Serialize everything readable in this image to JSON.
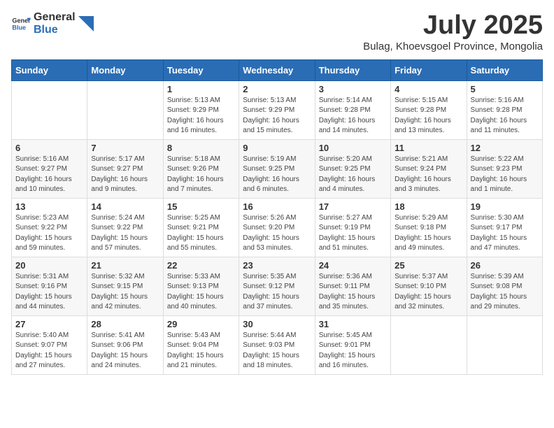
{
  "logo": {
    "general": "General",
    "blue": "Blue"
  },
  "title": "July 2025",
  "subtitle": "Bulag, Khoevsgoel Province, Mongolia",
  "days_of_week": [
    "Sunday",
    "Monday",
    "Tuesday",
    "Wednesday",
    "Thursday",
    "Friday",
    "Saturday"
  ],
  "weeks": [
    [
      {
        "day": "",
        "info": ""
      },
      {
        "day": "",
        "info": ""
      },
      {
        "day": "1",
        "info": "Sunrise: 5:13 AM\nSunset: 9:29 PM\nDaylight: 16 hours and 16 minutes."
      },
      {
        "day": "2",
        "info": "Sunrise: 5:13 AM\nSunset: 9:29 PM\nDaylight: 16 hours and 15 minutes."
      },
      {
        "day": "3",
        "info": "Sunrise: 5:14 AM\nSunset: 9:28 PM\nDaylight: 16 hours and 14 minutes."
      },
      {
        "day": "4",
        "info": "Sunrise: 5:15 AM\nSunset: 9:28 PM\nDaylight: 16 hours and 13 minutes."
      },
      {
        "day": "5",
        "info": "Sunrise: 5:16 AM\nSunset: 9:28 PM\nDaylight: 16 hours and 11 minutes."
      }
    ],
    [
      {
        "day": "6",
        "info": "Sunrise: 5:16 AM\nSunset: 9:27 PM\nDaylight: 16 hours and 10 minutes."
      },
      {
        "day": "7",
        "info": "Sunrise: 5:17 AM\nSunset: 9:27 PM\nDaylight: 16 hours and 9 minutes."
      },
      {
        "day": "8",
        "info": "Sunrise: 5:18 AM\nSunset: 9:26 PM\nDaylight: 16 hours and 7 minutes."
      },
      {
        "day": "9",
        "info": "Sunrise: 5:19 AM\nSunset: 9:25 PM\nDaylight: 16 hours and 6 minutes."
      },
      {
        "day": "10",
        "info": "Sunrise: 5:20 AM\nSunset: 9:25 PM\nDaylight: 16 hours and 4 minutes."
      },
      {
        "day": "11",
        "info": "Sunrise: 5:21 AM\nSunset: 9:24 PM\nDaylight: 16 hours and 3 minutes."
      },
      {
        "day": "12",
        "info": "Sunrise: 5:22 AM\nSunset: 9:23 PM\nDaylight: 16 hours and 1 minute."
      }
    ],
    [
      {
        "day": "13",
        "info": "Sunrise: 5:23 AM\nSunset: 9:22 PM\nDaylight: 15 hours and 59 minutes."
      },
      {
        "day": "14",
        "info": "Sunrise: 5:24 AM\nSunset: 9:22 PM\nDaylight: 15 hours and 57 minutes."
      },
      {
        "day": "15",
        "info": "Sunrise: 5:25 AM\nSunset: 9:21 PM\nDaylight: 15 hours and 55 minutes."
      },
      {
        "day": "16",
        "info": "Sunrise: 5:26 AM\nSunset: 9:20 PM\nDaylight: 15 hours and 53 minutes."
      },
      {
        "day": "17",
        "info": "Sunrise: 5:27 AM\nSunset: 9:19 PM\nDaylight: 15 hours and 51 minutes."
      },
      {
        "day": "18",
        "info": "Sunrise: 5:29 AM\nSunset: 9:18 PM\nDaylight: 15 hours and 49 minutes."
      },
      {
        "day": "19",
        "info": "Sunrise: 5:30 AM\nSunset: 9:17 PM\nDaylight: 15 hours and 47 minutes."
      }
    ],
    [
      {
        "day": "20",
        "info": "Sunrise: 5:31 AM\nSunset: 9:16 PM\nDaylight: 15 hours and 44 minutes."
      },
      {
        "day": "21",
        "info": "Sunrise: 5:32 AM\nSunset: 9:15 PM\nDaylight: 15 hours and 42 minutes."
      },
      {
        "day": "22",
        "info": "Sunrise: 5:33 AM\nSunset: 9:13 PM\nDaylight: 15 hours and 40 minutes."
      },
      {
        "day": "23",
        "info": "Sunrise: 5:35 AM\nSunset: 9:12 PM\nDaylight: 15 hours and 37 minutes."
      },
      {
        "day": "24",
        "info": "Sunrise: 5:36 AM\nSunset: 9:11 PM\nDaylight: 15 hours and 35 minutes."
      },
      {
        "day": "25",
        "info": "Sunrise: 5:37 AM\nSunset: 9:10 PM\nDaylight: 15 hours and 32 minutes."
      },
      {
        "day": "26",
        "info": "Sunrise: 5:39 AM\nSunset: 9:08 PM\nDaylight: 15 hours and 29 minutes."
      }
    ],
    [
      {
        "day": "27",
        "info": "Sunrise: 5:40 AM\nSunset: 9:07 PM\nDaylight: 15 hours and 27 minutes."
      },
      {
        "day": "28",
        "info": "Sunrise: 5:41 AM\nSunset: 9:06 PM\nDaylight: 15 hours and 24 minutes."
      },
      {
        "day": "29",
        "info": "Sunrise: 5:43 AM\nSunset: 9:04 PM\nDaylight: 15 hours and 21 minutes."
      },
      {
        "day": "30",
        "info": "Sunrise: 5:44 AM\nSunset: 9:03 PM\nDaylight: 15 hours and 18 minutes."
      },
      {
        "day": "31",
        "info": "Sunrise: 5:45 AM\nSunset: 9:01 PM\nDaylight: 15 hours and 16 minutes."
      },
      {
        "day": "",
        "info": ""
      },
      {
        "day": "",
        "info": ""
      }
    ]
  ]
}
